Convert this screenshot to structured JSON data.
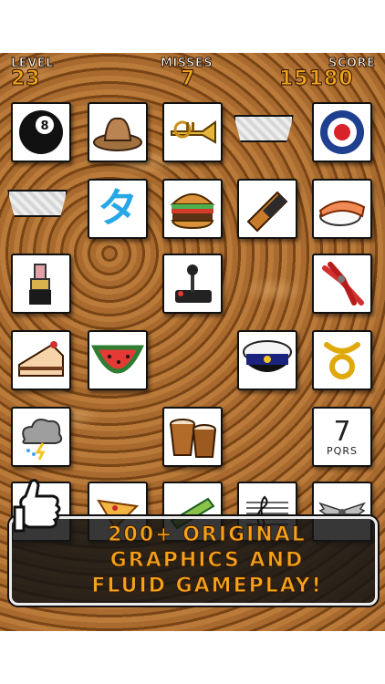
{
  "hud": {
    "level_label": "LEVEL",
    "level_value": "23",
    "misses_label": "MISSES",
    "misses_value": "7",
    "score_label": "SCORE",
    "score_value": "15180"
  },
  "tiles": {
    "eight_ball": "8",
    "katakana": "タ",
    "keypad_number": "7",
    "keypad_letters": "PQRS"
  },
  "banner": {
    "line1": "200+ ORIGINAL",
    "line2": "GRAPHICS AND",
    "line3": "FLUID GAMEPLAY!"
  },
  "colors": {
    "accent_orange": "#f3a21b",
    "board_brown": "#9a5c22",
    "katakana_blue": "#27a7e6"
  }
}
